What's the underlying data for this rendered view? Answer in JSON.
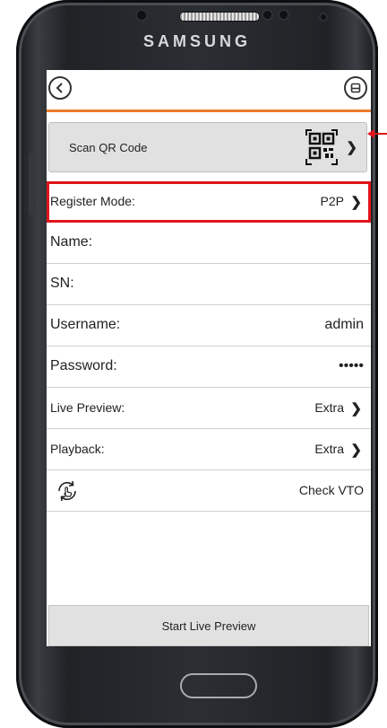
{
  "device": {
    "brand": "SAMSUNG"
  },
  "header": {
    "back_icon": "chevron-left-icon",
    "save_icon": "save-icon"
  },
  "scan": {
    "label": "Scan QR Code",
    "icon": "qr-code-icon"
  },
  "fields": {
    "register_mode": {
      "label": "Register Mode:",
      "value": "P2P"
    },
    "name": {
      "label": "Name:",
      "value": ""
    },
    "sn": {
      "label": "SN:",
      "value": ""
    },
    "username": {
      "label": "Username:",
      "value": "admin"
    },
    "password": {
      "label": "Password:",
      "value": "•••••"
    },
    "live_preview": {
      "label": "Live Preview:",
      "value": "Extra"
    },
    "playback": {
      "label": "Playback:",
      "value": "Extra"
    },
    "check_vto": {
      "label": "Check VTO",
      "icon": "rotate-hand-icon"
    }
  },
  "actions": {
    "start_live_preview": "Start Live Preview"
  },
  "colors": {
    "accent": "#ec7a2b",
    "highlight": "#e0141b"
  }
}
